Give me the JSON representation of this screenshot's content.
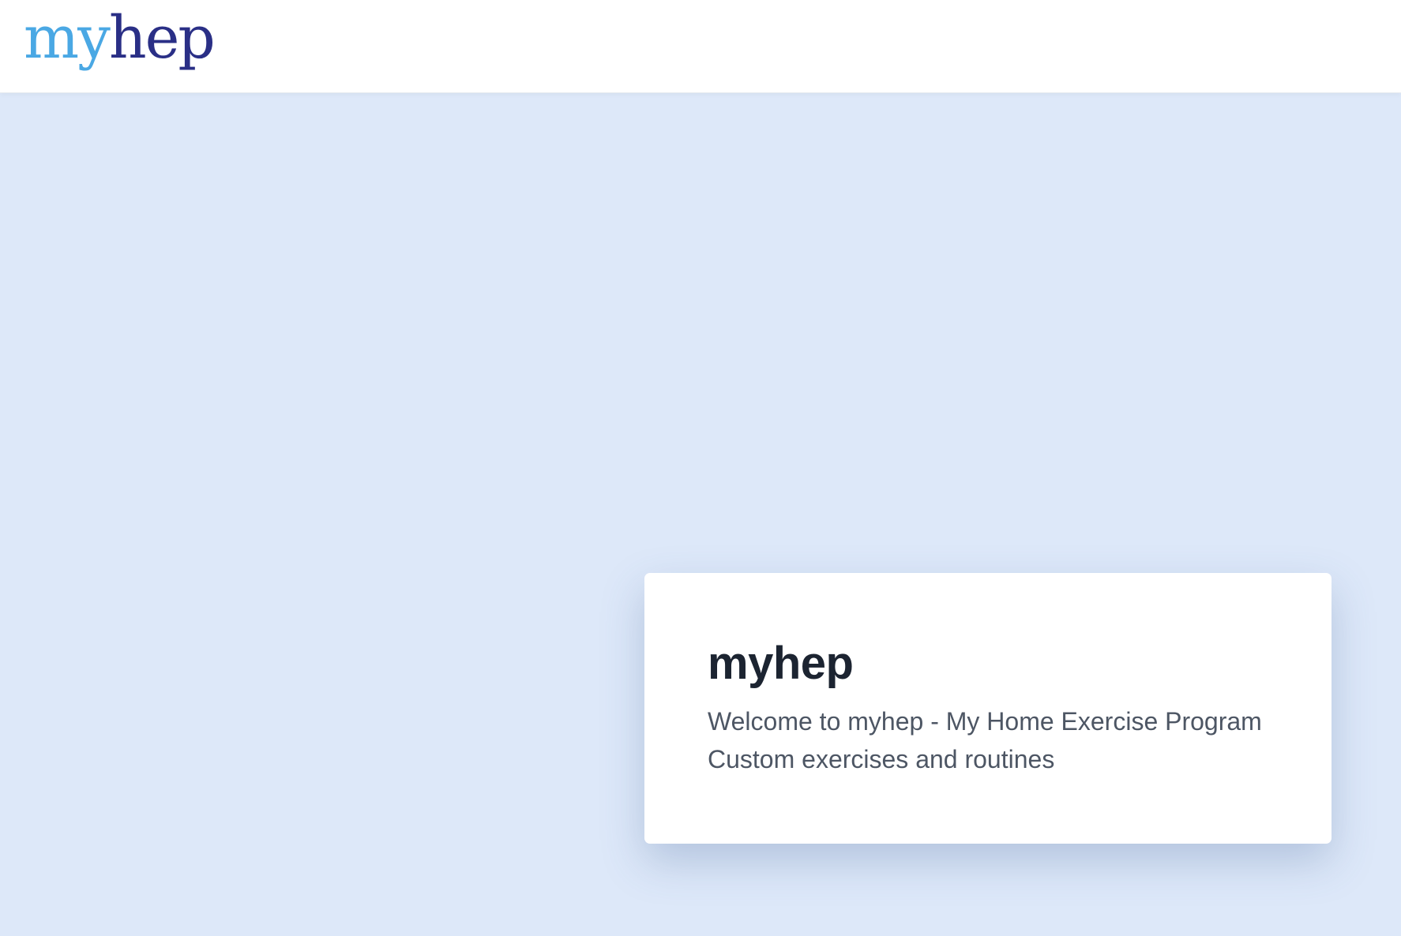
{
  "header": {
    "logo": {
      "part_a": "my",
      "part_b": "hep",
      "color_a": "#4aa8e4",
      "color_b": "#2a2f86"
    }
  },
  "card": {
    "title": "myhep",
    "lines": [
      "Welcome to myhep - My Home Exercise Program",
      "Custom exercises and routines"
    ]
  },
  "colors": {
    "page_background": "#dde8f9",
    "header_background": "#ffffff",
    "card_background": "#ffffff",
    "title_text": "#1c2431",
    "body_text": "#4d5664"
  }
}
